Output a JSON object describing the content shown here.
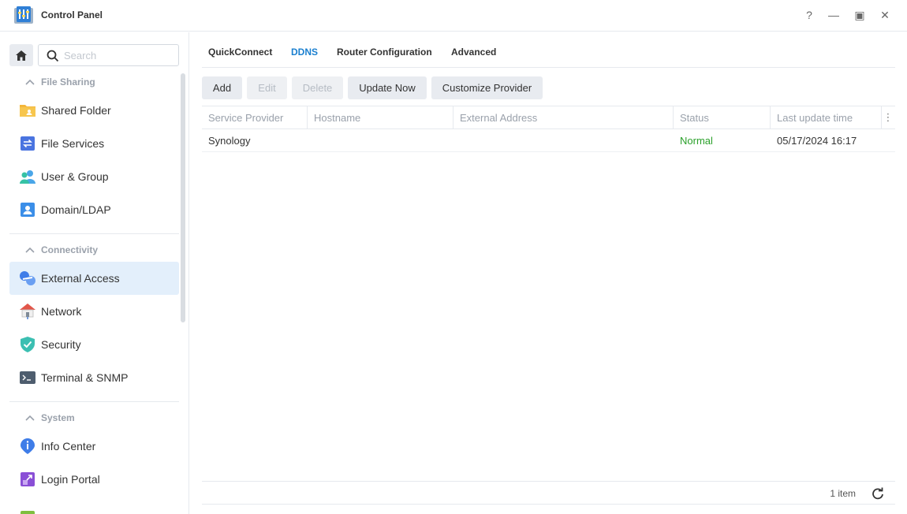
{
  "window": {
    "title": "Control Panel",
    "help_glyph": "?",
    "minimize_glyph": "—",
    "maximize_glyph": "▣",
    "close_glyph": "✕"
  },
  "sidebar": {
    "search": {
      "placeholder": "Search",
      "value": ""
    },
    "sections": [
      {
        "label": "File Sharing",
        "items": [
          {
            "label": "Shared Folder",
            "icon": "shared-folder-icon"
          },
          {
            "label": "File Services",
            "icon": "file-services-icon"
          },
          {
            "label": "User & Group",
            "icon": "user-group-icon"
          },
          {
            "label": "Domain/LDAP",
            "icon": "domain-ldap-icon"
          }
        ]
      },
      {
        "label": "Connectivity",
        "items": [
          {
            "label": "External Access",
            "icon": "external-access-icon",
            "active": true
          },
          {
            "label": "Network",
            "icon": "network-icon"
          },
          {
            "label": "Security",
            "icon": "security-shield-icon"
          },
          {
            "label": "Terminal & SNMP",
            "icon": "terminal-icon"
          }
        ]
      },
      {
        "label": "System",
        "items": [
          {
            "label": "Info Center",
            "icon": "info-center-icon"
          },
          {
            "label": "Login Portal",
            "icon": "login-portal-icon"
          }
        ]
      }
    ]
  },
  "tabs": [
    {
      "label": "QuickConnect",
      "active": false
    },
    {
      "label": "DDNS",
      "active": true
    },
    {
      "label": "Router Configuration",
      "active": false
    },
    {
      "label": "Advanced",
      "active": false
    }
  ],
  "toolbar": {
    "add": "Add",
    "edit": "Edit",
    "delete": "Delete",
    "update_now": "Update Now",
    "customize_provider": "Customize Provider"
  },
  "table": {
    "columns": [
      "Service Provider",
      "Hostname",
      "External Address",
      "Status",
      "Last update time"
    ],
    "column_menu_glyph": "⋮",
    "rows": [
      {
        "service_provider": "Synology",
        "hostname": "",
        "external_address": "",
        "status": "Normal",
        "last_update": "05/17/2024 16:17"
      }
    ]
  },
  "footer": {
    "count": "1 item"
  },
  "colors": {
    "accent": "#1a7fcf",
    "status_normal": "#2aa02a",
    "active_bg": "#e3effb"
  }
}
